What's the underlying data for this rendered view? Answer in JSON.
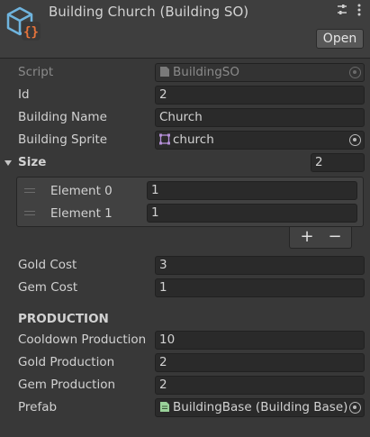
{
  "header": {
    "title": "Building Church (Building SO)",
    "open_label": "Open",
    "asset_icon": "scriptable-object-icon",
    "settings_icon": "preset-sliders-icon",
    "menu_icon": "kebab-menu-icon"
  },
  "fields": {
    "script": {
      "label": "Script",
      "value": "BuildingSO"
    },
    "id": {
      "label": "Id",
      "value": "2"
    },
    "building_name": {
      "label": "Building Name",
      "value": "Church"
    },
    "building_sprite": {
      "label": "Building Sprite",
      "value": "church"
    },
    "gold_cost": {
      "label": "Gold Cost",
      "value": "3"
    },
    "gem_cost": {
      "label": "Gem Cost",
      "value": "1"
    },
    "cooldown_production": {
      "label": "Cooldown Production",
      "value": "10"
    },
    "gold_production": {
      "label": "Gold Production",
      "value": "2"
    },
    "gem_production": {
      "label": "Gem Production",
      "value": "2"
    },
    "prefab": {
      "label": "Prefab",
      "value": "BuildingBase (Building Base)"
    }
  },
  "size_list": {
    "label": "Size",
    "count": "2",
    "elements": [
      {
        "label": "Element 0",
        "value": "1"
      },
      {
        "label": "Element 1",
        "value": "1"
      }
    ],
    "add_label": "+",
    "remove_label": "−"
  },
  "sections": {
    "production": "PRODUCTION"
  },
  "colors": {
    "background": "#383838",
    "field": "#2a2a2a",
    "accent_orange": "#e8743b",
    "accent_blue": "#4aa8d8"
  }
}
